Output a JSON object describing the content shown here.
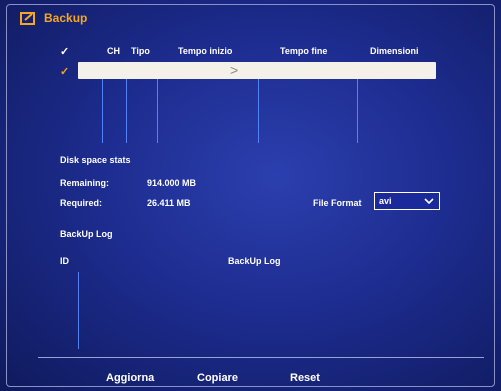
{
  "title": {
    "text": "Backup",
    "icon": "export-icon"
  },
  "table": {
    "columns": [
      "CH",
      "Tipo",
      "Tempo inizio",
      "Tempo fine",
      "Dimensioni"
    ],
    "header_check": "✓",
    "row_check": "✓",
    "selected_row": {
      "arrow": ">"
    }
  },
  "disk": {
    "section_title": "Disk space stats",
    "remaining_label": "Remaining:",
    "remaining_value": "914.000 MB",
    "required_label": "Required:",
    "required_value": "26.411 MB"
  },
  "file_format": {
    "label": "File Format",
    "value": "avi",
    "icon": "chevron-down-icon"
  },
  "log": {
    "section_title": "BackUp Log",
    "col_id": "ID",
    "col_log": "BackUp Log"
  },
  "buttons": {
    "refresh": "Aggiorna",
    "copy": "Copiare",
    "reset": "Reset"
  },
  "colors": {
    "accent": "#f5a623",
    "background": "#1d2c8f",
    "grid_line": "#5a8cff"
  }
}
